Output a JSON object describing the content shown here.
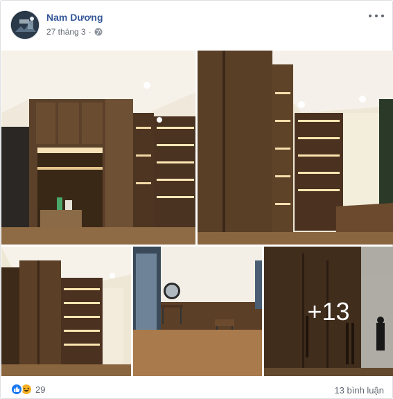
{
  "post": {
    "author": "Nam Dương",
    "date": "27 tháng 3",
    "privacy_icon": "globe-icon",
    "menu_icon": "more-options-icon"
  },
  "photos": {
    "more_count_label": "+13"
  },
  "footer": {
    "reaction_icons": [
      "like-icon",
      "haha-icon"
    ],
    "reaction_count": "29",
    "comments": "13 bình luận"
  }
}
